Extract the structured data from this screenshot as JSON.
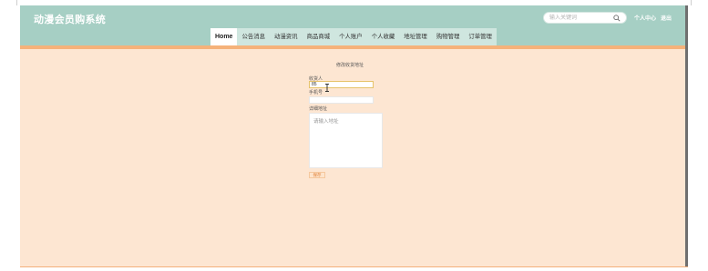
{
  "app": {
    "title": "动漫会员购系统"
  },
  "search": {
    "placeholder": "输入关键词"
  },
  "user": {
    "center": "个人中心",
    "logout": "退出"
  },
  "nav": {
    "items": [
      "Home",
      "公告消息",
      "动漫资讯",
      "商品商城",
      "个人账户",
      "个人收藏",
      "地址管理",
      "购物管理",
      "订单管理"
    ],
    "active": "Home"
  },
  "form": {
    "title": "修改收货地址",
    "recipient_label": "收货人",
    "recipient_value": "85",
    "phone_label": "手机号",
    "phone_value": "",
    "address_label": "详细地址",
    "address_placeholder": "请输入地址",
    "save_label": "保存"
  },
  "colors": {
    "header": "#a6cfc4",
    "nav": "#cfe6df",
    "band": "#f5b27a",
    "page": "#fde6d2"
  }
}
